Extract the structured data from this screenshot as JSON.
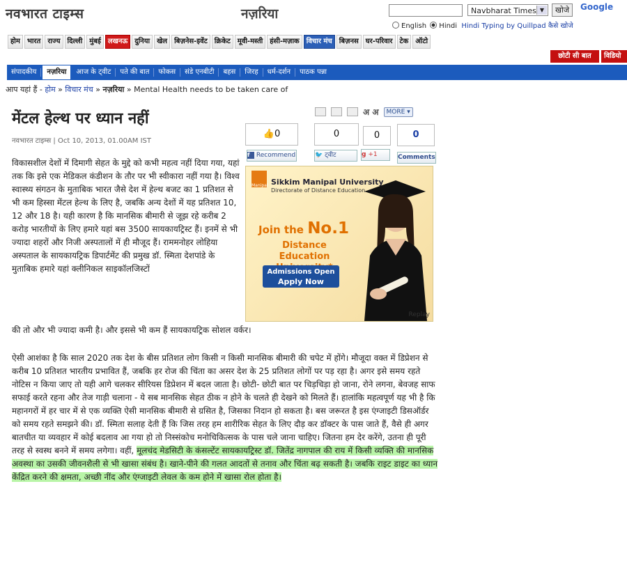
{
  "header": {
    "logo": "नवभारत टाइम्स",
    "section": "नज़रिया",
    "search_select": "Navbharat Times",
    "search_button": "खोजे",
    "google": "Google",
    "lang_english": "English",
    "lang_hindi": "Hindi",
    "typing_text": "Hindi Typing by Quillpad",
    "typing_link": "कैसे खोजे"
  },
  "main_nav": [
    "होम",
    "भारत",
    "राज्य",
    "दिल्ली",
    "मुंबई",
    "लखनऊ",
    "दुनिया",
    "खेल",
    "बिज़नेस-इवेंट",
    "क्रिकेट",
    "मूवी-मस्ती",
    "हंसी-मज़ाक",
    "विचार मंच",
    "बिज़नस",
    "घर-परिवार",
    "टेक",
    "ऑटो"
  ],
  "red_tabs": [
    "छोटी सी बात",
    "विडियो"
  ],
  "sub_nav": [
    "संपादकीय",
    "नज़रिया",
    "आज के ट्वीट",
    "पते की बात",
    "फोकस",
    "संडे एनबीटी",
    "बहस",
    "जिरह",
    "धर्म-दर्शन",
    "पाठक पन्ना"
  ],
  "breadcrumb": {
    "prefix": "आप यहां हैं -",
    "home": "होम",
    "sep": "»",
    "section": "विचार मंच",
    "sub": "नज़रिया",
    "current": "Mental Health needs to be taken care of"
  },
  "article": {
    "headline": "मेंटल हेल्थ पर ध्यान नहीं",
    "byline": "नवभारत टाइम्स | Oct 10, 2013, 01.00AM IST",
    "p1": "विकासशील देशों में दिमागी सेहत के मुद्दे को कभी महत्व नहीं दिया गया, यहां तक कि इसे एक मेडिकल कंडीशन के तौर पर भी स्वीकारा नहीं गया है। विश्व स्वास्थ्य संगठन के मुताबिक भारत जैसे देश में हेल्थ बजट का 1 प्रतिशत से भी कम हिस्सा मेंटल हेल्थ के लिए है, जबकि अन्य देशों में यह प्रतिशत 10, 12 और 18 है। यही कारण है कि मानसिक बीमारी से जूझ रहे करीब 2 करोड़ भारतीयों के लिए हमारे यहां बस 3500 सायकायट्रिस्ट हैं। इनमें से भी ज्यादा शहरों और निजी अस्पतालों में ही मौजूद हैं। राममनोहर लोहिया अस्पताल के सायकायट्रिक डिपार्टमेंट की प्रमुख डॉ. स्मिता देशपांडे के मुताबिक हमारे यहां क्लीनिकल साइकॉलजिस्टों",
    "p1_end": "की तो और भी ज्यादा कमी है। और इससे भी कम हैं सायकायट्रिक सोशल वर्कर।",
    "p2_a": "ऐसी आशंका है कि साल 2020 तक देश के बीस प्रतिशत लोग किसी न किसी मानसिक बीमारी की चपेट में होंगे। मौजूदा वक्त में डिप्रेशन से करीब 10 प्रतिशत भारतीय प्रभावित हैं, जबकि हर रोज की चिंता का असर देश के 25 प्रतिशत लोगों पर पड़ रहा है। अगर इसे समय रहते नोटिस न किया जाए तो यही आगे चलकर सीरियस डिप्रेशन में बदल जाता है। छोटी- छोटी बात पर चिड़चिड़ा हो जाना, रोने लगना, बेवजह साफ सफाई करते रहना और तेज गाड़ी चलाना - ये सब मानसिक सेहत ठीक न होने के चलते ही देखने को मिलते हैं। हालांकि महत्वपूर्ण यह भी है कि महानगरों में हर चार में से एक व्यक्ति ऐसी मानसिक बीमारी से ग्रसित है, जिसका निदान हो सकता है। बस जरूरत है इस एंग्जाइटी डिसऑर्डर को समय रहते समझने की। डॉ. स्मिता सलाह देती हैं कि जिस तरह हम शारीरिक सेहत के लिए दौड़ कर डॉक्टर के पास जाते हैं, वैसे ही अगर बातचीत या व्यवहार में कोई बदलाव आ गया हो तो निस्संकोच मनोचिकित्सक के पास चले जाना चाहिए। जितना हम देर करेंगे, उतना ही पूरी तरह से स्वस्थ बनने में समय लगेगा। वहीं,",
    "p2_highlight": "मूलचंद मेडसिटी के कंसल्टेंट सायकायट्रिस्ट डॉ. जितेंद्र नागपाल की राय में किसी व्यक्ति की मानसिक अवस्था का उसकी जीवनशैली से भी खासा संबंध है। खाने-पीने की गलत आदतों से तनाव और चिंता बढ़ सकती है। जबकि राइट डाइट का ध्यान केंद्रित करने की क्षमता, अच्छी नींद और एंग्जाइटी लेवल के कम होने में खासा रोल होता है।"
  },
  "tools": {
    "font_label": "अ अ",
    "more": "MORE"
  },
  "social": {
    "fb_count": "0",
    "box2": "0",
    "box3": "0",
    "comments_count": "0",
    "recommend": "Recommend",
    "tweet": "ट्वीट",
    "plus": "+1",
    "comments": "Comments"
  },
  "ad": {
    "university": "Sikkim Manipal University",
    "directorate": "Directorate of Distance Education",
    "join": "Join the",
    "no1": "No.1",
    "distance": "Distance Education University*",
    "btn_line1": "Admissions Open",
    "btn_line2": "Apply Now",
    "replay": "Replay",
    "logo_text": "Manipal"
  }
}
